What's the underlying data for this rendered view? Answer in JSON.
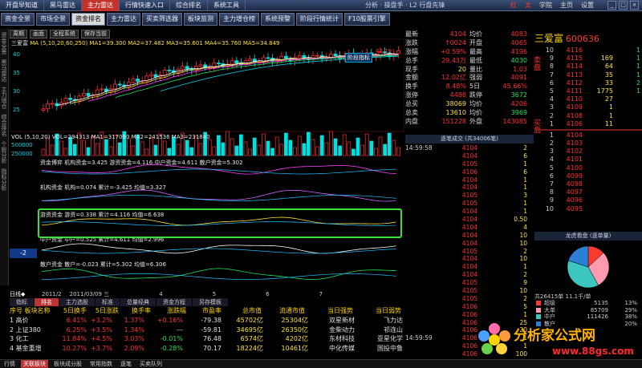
{
  "menubar": {
    "items": [
      "开盘早知道",
      "黑马雷达",
      "主力雷达",
      "行情快速入口",
      "综合排名",
      "系统工具"
    ],
    "active_index": 2,
    "center_title": "分析 · 操盘手 · L2 行盘先锋",
    "right_items": [
      "红",
      "太",
      "学院",
      "主页",
      "设置"
    ]
  },
  "toolbar": {
    "buttons": [
      "资金全景",
      "市场全景",
      "资金排名",
      "主力雷达",
      "买卖筛选器",
      "板块监测",
      "主力增仓榜",
      "系统预警",
      "阶段行情统计",
      "F10股票引擎"
    ],
    "active_index": 2
  },
  "side_tabs": [
    "资金全景",
    "黑马雷达",
    "主力增仓",
    "综合排名",
    "个股分析",
    "指标分析"
  ],
  "chart_header": {
    "buttons": [
      "周期",
      "画面",
      "全程系统",
      "保存当前"
    ]
  },
  "kline": {
    "label": "三爱富",
    "ma_line": "MA (5,10,20,60,250) MA1=39.300 MA2=37.482 MA3=35.601 MA4=35.760 MA5=34.849",
    "yticks": [
      "40",
      "35",
      "30",
      "25"
    ],
    "high_label": "42.19",
    "tag": "阶段指标"
  },
  "vol": {
    "line": "VOL (5,10,20) VOL=294313 MA1=317080 MA2=241536 MA3=231840",
    "yticks": [
      "500000",
      "250000"
    ]
  },
  "panels": [
    {
      "line": "资金博弈  机构资金=3.425  游资资金=4.116  中户资金=4.611  散户资金=5.302"
    },
    {
      "line": "机构资金  机构=0.074  累计=-3.425  均值=3.327"
    },
    {
      "line": "游资资金  游资=0.338  累计=4.116  均值=6.638"
    },
    {
      "line": "中户资金  中户=0.525  累计=4.611  均值=2.996"
    },
    {
      "line": "散户资金  散户=-0.023  累计=5.302  均值=6.306"
    }
  ],
  "date_bar": {
    "label": "日线◆",
    "items": [
      "2011/2",
      "2011/03/09 三",
      "4",
      "5",
      "6",
      "7"
    ],
    "left_value": "-2"
  },
  "quote": {
    "rows": [
      {
        "k": "最新",
        "v": "4104",
        "k2": "均价",
        "v2": "4083"
      },
      {
        "k": "涨跌",
        "v": "↑0024",
        "k2": "开盘",
        "v2": "4065"
      },
      {
        "k": "涨幅",
        "v": "+0.59%",
        "k2": "最高",
        "v2": "4196"
      },
      {
        "k": "总手",
        "v": "29.43万",
        "k2": "最低",
        "v2": "4030"
      },
      {
        "k": "现手",
        "v": "20",
        "k2": "量比",
        "v2": "1.03"
      },
      {
        "k": "金额",
        "v": "12.02亿",
        "k2": "强弱",
        "v2": "4091"
      },
      {
        "k": "换手",
        "v": "8.48%",
        "k2": "5日",
        "v2": "45.66%"
      },
      {
        "k": "涨停",
        "v": "4488",
        "k2": "跌停",
        "v2": "3672"
      },
      {
        "k": "总买",
        "v": "38069",
        "k2": "均价",
        "v2": "4206"
      },
      {
        "k": "总卖",
        "v": "13610",
        "k2": "均价",
        "v2": "3969"
      },
      {
        "k": "内盘",
        "v": "151228",
        "k2": "外盘",
        "v2": "143085"
      }
    ]
  },
  "stock": {
    "name": "三爱富",
    "code": "600636"
  },
  "orderbook": {
    "sell": [
      {
        "n": "10",
        "p": "4116",
        "q": "",
        "d": "1"
      },
      {
        "n": "9",
        "p": "4115",
        "q": "169",
        "d": "1"
      },
      {
        "n": "8",
        "p": "4114",
        "q": "64",
        "d": "1"
      },
      {
        "n": "7",
        "p": "4113",
        "q": "35",
        "d": "1"
      },
      {
        "n": "6",
        "p": "4112",
        "q": "33",
        "d": "2"
      },
      {
        "n": "5",
        "p": "4111",
        "q": "1775",
        "d": "1"
      },
      {
        "n": "4",
        "p": "4110",
        "q": "27",
        "d": ""
      },
      {
        "n": "3",
        "p": "4109",
        "q": "1",
        "d": ""
      },
      {
        "n": "2",
        "p": "4108",
        "q": "1",
        "d": ""
      },
      {
        "n": "1",
        "p": "4106",
        "q": "11",
        "d": ""
      }
    ],
    "buy": [
      {
        "n": "1",
        "p": "4104",
        "q": "",
        "d": ""
      },
      {
        "n": "2",
        "p": "4103",
        "q": "",
        "d": ""
      },
      {
        "n": "3",
        "p": "4102",
        "q": "",
        "d": ""
      },
      {
        "n": "4",
        "p": "4101",
        "q": "",
        "d": ""
      },
      {
        "n": "5",
        "p": "4100",
        "q": "",
        "d": ""
      },
      {
        "n": "6",
        "p": "4099",
        "q": "",
        "d": ""
      },
      {
        "n": "7",
        "p": "4098",
        "q": "",
        "d": ""
      },
      {
        "n": "8",
        "p": "4097",
        "q": "",
        "d": ""
      },
      {
        "n": "9",
        "p": "4096",
        "q": "",
        "d": ""
      },
      {
        "n": "10",
        "p": "4095",
        "q": "",
        "d": ""
      }
    ],
    "side_sell": "卖盘",
    "side_buy": "买盘"
  },
  "trades": {
    "title": "逐笔成交 (共34006笔)",
    "rows": [
      {
        "t": "14:59:58",
        "p": "4104",
        "v": "2"
      },
      {
        "t": "",
        "p": "4104",
        "v": "6"
      },
      {
        "t": "",
        "p": "4105",
        "v": "1"
      },
      {
        "t": "",
        "p": "4106",
        "v": "6"
      },
      {
        "t": "",
        "p": "4104",
        "v": "1"
      },
      {
        "t": "",
        "p": "4104",
        "v": "1"
      },
      {
        "t": "",
        "p": "4105",
        "v": "3"
      },
      {
        "t": "",
        "p": "4105",
        "v": "1"
      },
      {
        "t": "",
        "p": "4104",
        "v": "1"
      },
      {
        "t": "",
        "p": "4104",
        "v": "0.50"
      },
      {
        "t": "",
        "p": "4104",
        "v": "4"
      },
      {
        "t": "",
        "p": "4104",
        "v": "10"
      },
      {
        "t": "",
        "p": "4104",
        "v": "10"
      },
      {
        "t": "",
        "p": "4105",
        "v": "2"
      },
      {
        "t": "",
        "p": "4104",
        "v": "10"
      },
      {
        "t": "",
        "p": "4104",
        "v": "1"
      },
      {
        "t": "",
        "p": "4104",
        "v": "2"
      },
      {
        "t": "",
        "p": "4105",
        "v": "9"
      },
      {
        "t": "",
        "p": "4105",
        "v": "10"
      },
      {
        "t": "",
        "p": "4105",
        "v": "2"
      },
      {
        "t": "",
        "p": "4106",
        "v": "5"
      },
      {
        "t": "",
        "p": "4106",
        "v": "1"
      },
      {
        "t": "",
        "p": "4106",
        "v": "25"
      },
      {
        "t": "",
        "p": "4106",
        "v": "20"
      },
      {
        "t": "14:59:59",
        "p": "4106",
        "v": "1"
      },
      {
        "t": "",
        "p": "4106",
        "v": "1"
      },
      {
        "t": "",
        "p": "4106",
        "v": "100"
      }
    ]
  },
  "dragon": {
    "title": "龙虎看盘 (逐单量)",
    "summary": "共26415单 11.1千/单",
    "legend": [
      {
        "k": "超级",
        "v": "5135",
        "pct": "13%",
        "color": "#ff3b30"
      },
      {
        "k": "大单",
        "v": "85709",
        "pct": "29%",
        "color": "#ff9ab0"
      },
      {
        "k": "中户",
        "v": "111426",
        "pct": "38%",
        "color": "#3cc6c0"
      },
      {
        "k": "散户",
        "v": "",
        "pct": "20%",
        "color": "#2a7fd6"
      }
    ]
  },
  "rank": {
    "tabs": [
      "指标",
      "排名",
      "主力选股",
      "标准",
      "总量经典",
      "资金方程",
      "另存模板"
    ],
    "active_index": 1,
    "header": [
      "序号 板块名称",
      "5日换手",
      "5日涨跌",
      "换手率",
      "涨跌幅",
      "市盈率",
      "总市值",
      "流通市值",
      "当日强势",
      "当日弱势"
    ],
    "rows": [
      {
        "c1": "1 高价",
        "c2": "6.41%",
        "c3": "+3.2%",
        "c4": "1.37%",
        "c5": "+0.16%",
        "c6": "-79.38",
        "c7": "45702亿",
        "c8": "25304亿",
        "c9": "双星新材",
        "c10": "飞力达"
      },
      {
        "c1": "2 上证380",
        "c2": "6.25%",
        "c3": "+3.5%",
        "c4": "1.34%",
        "c5": "—",
        "c6": "-59.81",
        "c7": "34695亿",
        "c8": "26350亿",
        "c9": "金柴动力",
        "c10": "祁连山"
      },
      {
        "c1": "3 化工",
        "c2": "11.84%",
        "c3": "+4.5%",
        "c4": "3.03%",
        "c5": "-0.01%",
        "c6": "76.48",
        "c7": "6574亿",
        "c8": "4202亿",
        "c9": "东材科技",
        "c10": "亚星化学"
      },
      {
        "c1": "4 基金重增",
        "c2": "10.27%",
        "c3": "+3.7%",
        "c4": "2.09%",
        "c5": "-0.28%",
        "c6": "70.17",
        "c7": "18224亿",
        "c8": "10461亿",
        "c9": "中化传媒",
        "c10": "国投中鲁"
      }
    ]
  },
  "bottom_tabs": [
    "行情",
    "关联板块",
    "板块成分股",
    "常用指数",
    "逐笔",
    "买卖队列"
  ],
  "bottom_active": 1,
  "watermark": {
    "text": "分析家公式网",
    "url": "www.88gs.com"
  }
}
